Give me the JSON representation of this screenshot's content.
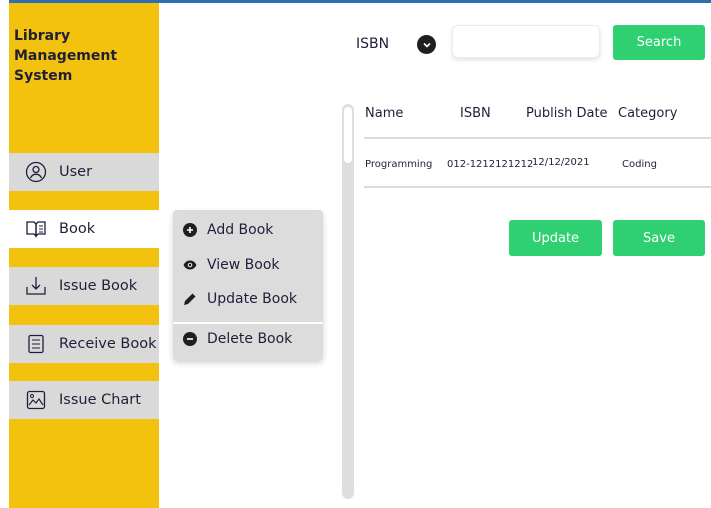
{
  "app": {
    "title_line1": "Library",
    "title_line2": "Management",
    "title_line3": "System"
  },
  "sidebar": {
    "items": [
      {
        "label": "User",
        "icon": "user-circle-icon",
        "active": false
      },
      {
        "label": "Book",
        "icon": "open-book-icon",
        "active": true
      },
      {
        "label": "Issue Book",
        "icon": "download-tray-icon",
        "active": false
      },
      {
        "label": "Receive Book",
        "icon": "clipboard-icon",
        "active": false
      },
      {
        "label": "Issue Chart",
        "icon": "image-chart-icon",
        "active": false
      }
    ]
  },
  "book_menu": {
    "items": [
      {
        "label": "Add Book",
        "icon": "plus-circle-icon"
      },
      {
        "label": "View Book",
        "icon": "eye-icon"
      },
      {
        "label": "Update Book",
        "icon": "pencil-icon"
      },
      {
        "label": "Delete Book",
        "icon": "minus-circle-icon"
      }
    ]
  },
  "search": {
    "field_label": "ISBN",
    "value": "",
    "placeholder": "",
    "button_label": "Search"
  },
  "table": {
    "columns": [
      "Name",
      "ISBN",
      "Publish Date",
      "Category"
    ],
    "rows": [
      [
        "Programming",
        "012-1212121212",
        "12/12/2021",
        "Coding"
      ]
    ]
  },
  "actions": {
    "update_label": "Update",
    "save_label": "Save"
  },
  "colors": {
    "sidebar": "#f2c20f",
    "accent_green": "#2fd071",
    "active_item": "#ffffff",
    "inactive_item": "#d9d9d9"
  }
}
